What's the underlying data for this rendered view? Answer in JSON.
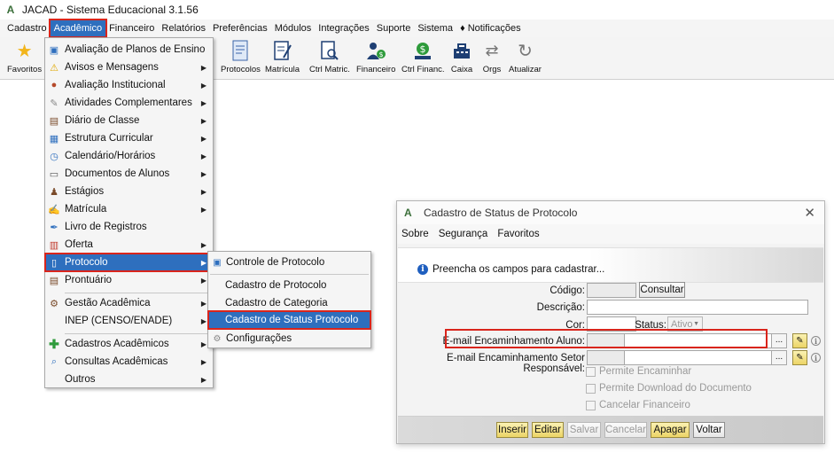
{
  "window": {
    "title": "JACAD - Sistema Educacional 3.1.56",
    "logo": "A"
  },
  "menubar": {
    "items": [
      "Cadastro",
      "Acadêmico",
      "Financeiro",
      "Relatórios",
      "Preferências",
      "Módulos",
      "Integrações",
      "Suporte",
      "Sistema",
      "Notificações"
    ]
  },
  "toolbar": {
    "favoritos": "Favoritos",
    "protocolos": "Protocolos",
    "matricula": "Matrícula",
    "ctrl_matric": "Ctrl Matric.",
    "financeiro": "Financeiro",
    "ctrl_financ": "Ctrl Financ.",
    "caixa": "Caixa",
    "orgs": "Orgs",
    "atualizar": "Atualizar"
  },
  "academico_menu": {
    "items": [
      "Avaliação de Planos de Ensino",
      "Avisos e Mensagens",
      "Avaliação Institucional",
      "Atividades Complementares",
      "Diário de Classe",
      "Estrutura Curricular",
      "Calendário/Horários",
      "Documentos de Alunos",
      "Estágios",
      "Matrícula",
      "Livro de Registros",
      "Oferta",
      "Protocolo",
      "Prontuário",
      "Gestão Acadêmica",
      "INEP (CENSO/ENADE)",
      "Cadastros Acadêmicos",
      "Consultas Acadêmicas",
      "Outros"
    ]
  },
  "protocolo_submenu": {
    "items": [
      "Controle de Protocolo",
      "Cadastro de Protocolo",
      "Cadastro de Categoria",
      "Cadastro de Status Protocolo",
      "Configurações"
    ]
  },
  "dialog": {
    "title": "Cadastro de Status de Protocolo",
    "logo": "A",
    "close": "✕",
    "menu": [
      "Sobre",
      "Segurança",
      "Favoritos"
    ],
    "info_message": "Preencha os campos para cadastrar...",
    "labels": {
      "codigo": "Código:",
      "descricao": "Descrição:",
      "cor": "Cor:",
      "status": "Status:",
      "email_aluno": "E-mail Encaminhamento Aluno:",
      "email_setor": "E-mail Encaminhamento Setor Responsável:"
    },
    "consultar": "Consultar",
    "status_value": "Ativo",
    "dots": "...",
    "checkboxes": [
      "Permite Encaminhar",
      "Permite Download do Documento",
      "Cancelar Financeiro"
    ],
    "buttons": {
      "inserir": "Inserir",
      "editar": "Editar",
      "salvar": "Salvar",
      "cancelar": "Cancelar",
      "apagar": "Apagar",
      "voltar": "Voltar"
    }
  }
}
